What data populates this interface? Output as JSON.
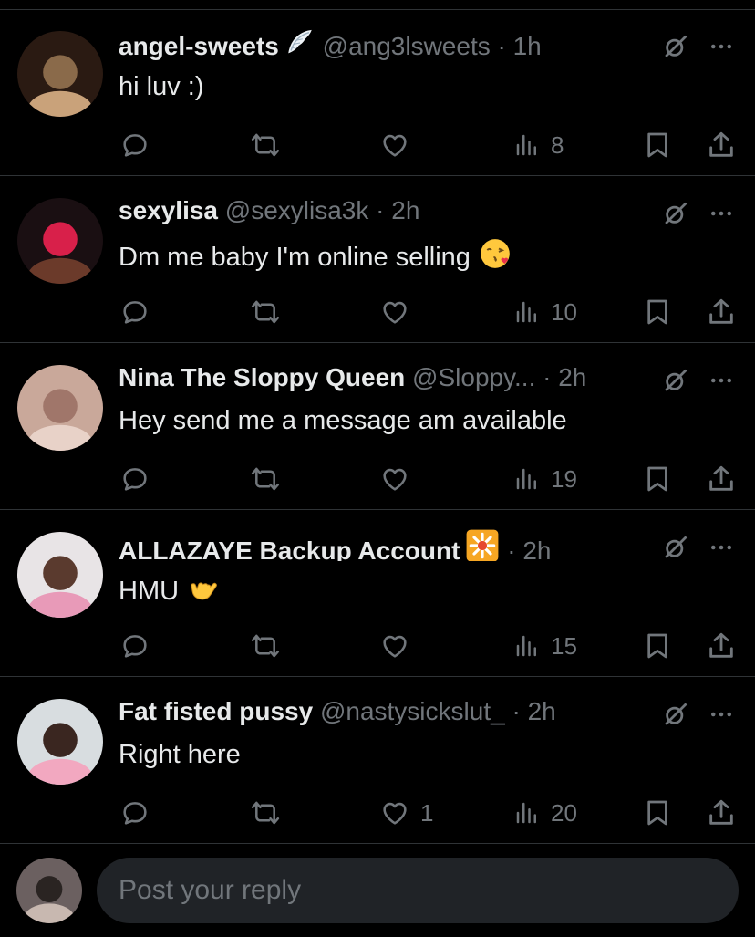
{
  "replies": [
    {
      "name": "angel-sweets",
      "badge": "wing-emoji",
      "handle": "@ang3lsweets",
      "dot": "·",
      "time": "1h",
      "text": "hi luv :)",
      "text_emoji": "",
      "replies_count": "",
      "reposts_count": "",
      "likes_count": "",
      "views_count": "8",
      "avatar_colors": [
        "#2a1a12",
        "#8a6a4a",
        "#c9a27a"
      ]
    },
    {
      "name": "sexylisa",
      "badge": "",
      "handle": "@sexylisa3k",
      "dot": "·",
      "time": "2h",
      "text": "Dm me baby I'm online selling",
      "text_emoji": "kissing-face-emoji",
      "replies_count": "",
      "reposts_count": "",
      "likes_count": "",
      "views_count": "10",
      "avatar_colors": [
        "#1a0f12",
        "#d8204a",
        "#6b3a2a"
      ]
    },
    {
      "name": "Nina The Sloppy Queen",
      "badge": "",
      "handle": "@Sloppy...",
      "dot": "·",
      "time": "2h",
      "text": "Hey send me a message am available",
      "text_emoji": "",
      "replies_count": "",
      "reposts_count": "",
      "likes_count": "",
      "views_count": "19",
      "avatar_colors": [
        "#c9a89a",
        "#a0766a",
        "#e8d2c8"
      ]
    },
    {
      "name": "ALLAZAYE Backup Account",
      "badge": "sparkle-badge",
      "handle": "",
      "dot": "·",
      "time": "2h",
      "text": "HMU",
      "text_emoji": "call-me-hand-emoji",
      "replies_count": "",
      "reposts_count": "",
      "likes_count": "",
      "views_count": "15",
      "avatar_colors": [
        "#e8e4e6",
        "#5a3a2e",
        "#e89ab8"
      ]
    },
    {
      "name": "Fat fisted pussy",
      "badge": "",
      "handle": "@nastysickslut_",
      "dot": "·",
      "time": "2h",
      "text": "Right here",
      "text_emoji": "",
      "replies_count": "",
      "reposts_count": "",
      "likes_count": "1",
      "views_count": "20",
      "avatar_colors": [
        "#d8dde0",
        "#3a2620",
        "#f2a8c0"
      ]
    }
  ],
  "composer": {
    "placeholder": "Post your reply",
    "avatar_colors": [
      "#6b6060",
      "#2a2422",
      "#c8b8b0"
    ]
  }
}
